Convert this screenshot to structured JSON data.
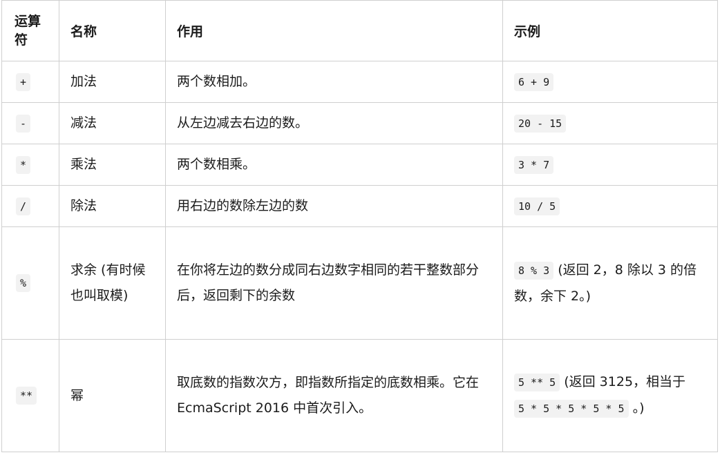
{
  "headers": {
    "operator": "运算符",
    "name": "名称",
    "effect": "作用",
    "example": "示例"
  },
  "rows": [
    {
      "symbol": "+",
      "name": "加法",
      "effect": "两个数相加。",
      "example_code": "6 + 9"
    },
    {
      "symbol": "-",
      "name": "减法",
      "effect": "从左边减去右边的数。",
      "example_code": "20 - 15"
    },
    {
      "symbol": "*",
      "name": "乘法",
      "effect": "两个数相乘。",
      "example_code": "3 * 7"
    },
    {
      "symbol": "/",
      "name": "除法",
      "effect": "用右边的数除左边的数",
      "example_code": "10 / 5"
    },
    {
      "symbol": "%",
      "name": "求余 (有时候也叫取模)",
      "effect": "在你将左边的数分成同右边数字相同的若干整数部分后，返回剩下的余数",
      "example_code": "8 % 3",
      "example_note": " (返回 2，8 除以 3 的倍数，余下 2。)"
    },
    {
      "symbol": "**",
      "name": "幂",
      "effect": "取底数的指数次方，即指数所指定的底数相乘。它在 EcmaScript 2016 中首次引入。",
      "example_code": "5 ** 5",
      "example_note": " (返回 3125，相当于 ",
      "example_code_2": "5 * 5 * 5 * 5 * 5",
      "example_note_2": " 。)"
    }
  ]
}
